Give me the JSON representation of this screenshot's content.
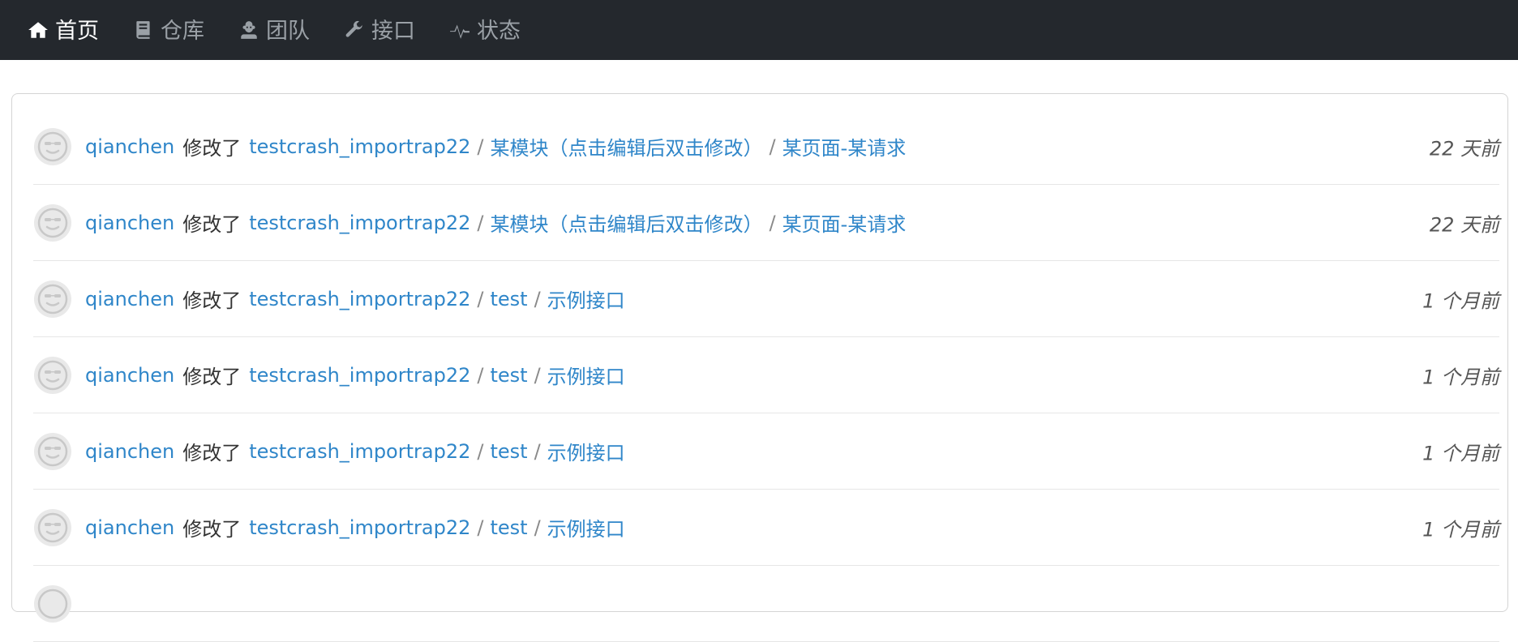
{
  "nav": {
    "items": [
      {
        "label": "首页",
        "icon": "home-icon",
        "active": true
      },
      {
        "label": "仓库",
        "icon": "book-icon",
        "active": false
      },
      {
        "label": "团队",
        "icon": "team-icon",
        "active": false
      },
      {
        "label": "接口",
        "icon": "wrench-icon",
        "active": false
      },
      {
        "label": "状态",
        "icon": "pulse-icon",
        "active": false
      }
    ]
  },
  "feed": {
    "items": [
      {
        "user": "qianchen",
        "verb": "修改了",
        "repo": "testcrash_importrap22",
        "module": "某模块（点击编辑后双击修改）",
        "page": "某页面-某请求",
        "time": "22 天前"
      },
      {
        "user": "qianchen",
        "verb": "修改了",
        "repo": "testcrash_importrap22",
        "module": "某模块（点击编辑后双击修改）",
        "page": "某页面-某请求",
        "time": "22 天前"
      },
      {
        "user": "qianchen",
        "verb": "修改了",
        "repo": "testcrash_importrap22",
        "module": "test",
        "page": "示例接口",
        "time": "1 个月前"
      },
      {
        "user": "qianchen",
        "verb": "修改了",
        "repo": "testcrash_importrap22",
        "module": "test",
        "page": "示例接口",
        "time": "1 个月前"
      },
      {
        "user": "qianchen",
        "verb": "修改了",
        "repo": "testcrash_importrap22",
        "module": "test",
        "page": "示例接口",
        "time": "1 个月前"
      },
      {
        "user": "qianchen",
        "verb": "修改了",
        "repo": "testcrash_importrap22",
        "module": "test",
        "page": "示例接口",
        "time": "1 个月前"
      }
    ],
    "separator": "/"
  }
}
